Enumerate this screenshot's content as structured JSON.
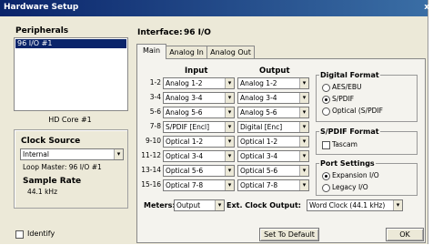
{
  "window": {
    "title": "Hardware Setup",
    "close_glyph": "x"
  },
  "peripherals": {
    "label": "Peripherals",
    "items": [
      "96 I/O #1"
    ],
    "core": "HD Core #1"
  },
  "clock": {
    "title": "Clock Source",
    "selected": "Internal",
    "loop_master": "Loop Master: 96 I/O #1",
    "sample_rate_label": "Sample Rate",
    "sample_rate_value": "44.1 kHz"
  },
  "interface": {
    "label": "Interface:",
    "value": "96 I/O"
  },
  "tabs": [
    "Main",
    "Analog In",
    "Analog Out"
  ],
  "io": {
    "input_header": "Input",
    "output_header": "Output",
    "rows": [
      {
        "label": "1-2",
        "input": "Analog 1-2",
        "output": "Analog 1-2"
      },
      {
        "label": "3-4",
        "input": "Analog 3-4",
        "output": "Analog 3-4"
      },
      {
        "label": "5-6",
        "input": "Analog 5-6",
        "output": "Analog 5-6"
      },
      {
        "label": "7-8",
        "input": "S/PDIF [Encl]",
        "output": "Digital [Enc]"
      },
      {
        "label": "9-10",
        "input": "Optical 1-2",
        "output": "Optical 1-2"
      },
      {
        "label": "11-12",
        "input": "Optical 3-4",
        "output": "Optical 3-4"
      },
      {
        "label": "13-14",
        "input": "Optical 5-6",
        "output": "Optical 5-6"
      },
      {
        "label": "15-16",
        "input": "Optical 7-8",
        "output": "Optical 7-8"
      }
    ]
  },
  "digital_format": {
    "title": "Digital Format",
    "options": [
      "AES/EBU",
      "S/PDIF",
      "Optical (S/PDIF"
    ],
    "selected_index": 1
  },
  "spdif_format": {
    "title": "S/PDIF Format",
    "option": "Tascam",
    "checked": false
  },
  "port_settings": {
    "title": "Port Settings",
    "options": [
      "Expansion I/O",
      "Legacy I/O"
    ],
    "selected_index": 0
  },
  "meters": {
    "label": "Meters:",
    "value": "Output"
  },
  "ext_clock": {
    "label": "Ext. Clock Output:",
    "value": "Word Clock (44.1 kHz)"
  },
  "footer": {
    "identify": "Identify",
    "identify_checked": false,
    "default_button": "Set To Default",
    "ok_button": "OK"
  },
  "icons": {
    "dropdown": "chevron-down-icon"
  },
  "colors": {
    "titlebar": "#0a246a",
    "selection": "#0a246a",
    "window_bg": "#ece9d8"
  }
}
